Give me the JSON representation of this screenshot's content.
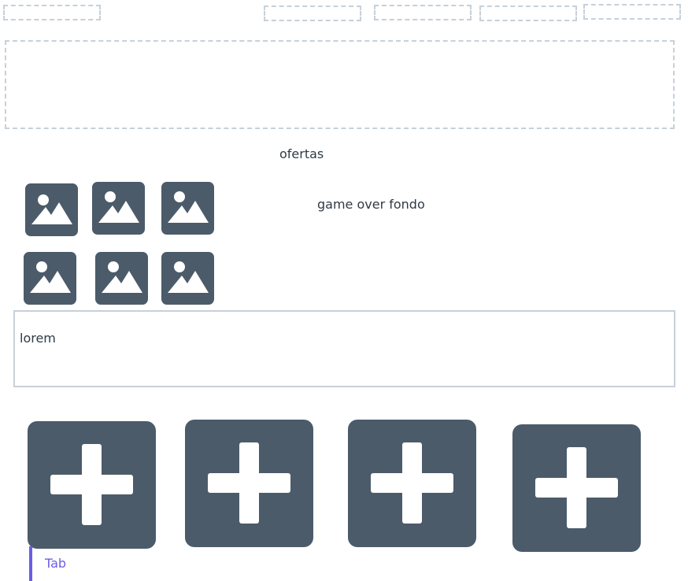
{
  "nav": {
    "placeholders": [
      "nav-slot-1",
      "nav-slot-2",
      "nav-slot-3",
      "nav-slot-4",
      "nav-slot-5"
    ]
  },
  "section": {
    "heading": "ofertas",
    "caption": "game over fondo"
  },
  "text_area": {
    "value": "lorem"
  },
  "tab": {
    "label": "Tab"
  },
  "colors": {
    "icon_bg": "#4b5b6a",
    "placeholder_border": "#c7d0d9",
    "tab_accent": "#6c5ce7"
  }
}
